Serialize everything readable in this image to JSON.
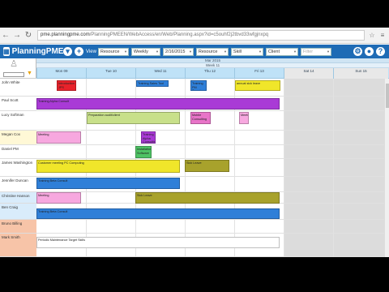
{
  "browser": {
    "url_domain": "pme.planningpme.com",
    "url_path": "/PlanningPMEEN/WebAccess/en/Web/Planning.aspx?id=c5ouhf2j2tbvd33wfgjnxpq"
  },
  "app": {
    "name": "PlanningPME"
  },
  "toolbar": {
    "view_label": "View",
    "view_value": "Resource",
    "period_value": "Weekly",
    "date_value": "2/16/2015",
    "resource_filter": "Resource",
    "skill_filter": "Skill",
    "client_filter": "Client",
    "search_placeholder": "Filter"
  },
  "timeline": {
    "month": "Mar 2015",
    "week": "Week 11",
    "days": [
      "Mon 09",
      "Tue 10",
      "Wed 11",
      "Thu 12",
      "Fri 13",
      "Sat 14",
      "Sun 15"
    ]
  },
  "resources": [
    {
      "name": "John White",
      "color": "#ffffff"
    },
    {
      "name": "Paul Scott",
      "color": "#ffffff"
    },
    {
      "name": "Lucy Softman",
      "color": "#ffffff"
    },
    {
      "name": "Megan Cox",
      "color": "#fff8d6"
    },
    {
      "name": "Daniel PM",
      "color": "#ffffff"
    },
    {
      "name": "James Washington",
      "color": "#ffffff"
    },
    {
      "name": "Jennifer Duncan",
      "color": "#ffffff"
    },
    {
      "name": "Christine Hanson",
      "color": "#d9ecfb"
    },
    {
      "name": "Ben Craig",
      "color": "#d9ecfb"
    },
    {
      "name": "Bruno Billing",
      "color": "#f7c4a8"
    },
    {
      "name": "Mark Smith",
      "color": "#f7c4a8"
    }
  ],
  "tasks": [
    {
      "label": "Introduction JPS",
      "color": "#e8222b"
    },
    {
      "label": "Training Sales Tool Client",
      "color": "#2f7fd8"
    },
    {
      "label": "Training PM Target Inc",
      "color": "#2f7fd8"
    },
    {
      "label": "annual sick leave",
      "color": "#f0e62a"
    },
    {
      "label": "Training Alpha Consult",
      "color": "#a93ad6"
    },
    {
      "label": "Preparation audit/client",
      "color": "#c8e08a"
    },
    {
      "label": "Mobile Consulting",
      "color": "#e874c8"
    },
    {
      "label": "Meeting",
      "color": "#f7a8df"
    },
    {
      "label": "Meeting",
      "color": "#f7a8df"
    },
    {
      "label": "Training Alpha Consulting",
      "color": "#a93ad6"
    },
    {
      "label": "Installation Software",
      "color": "#4ec264"
    },
    {
      "label": "Customer meeting PC Computing",
      "color": "#f0e62a"
    },
    {
      "label": "Sick Leave",
      "color": "#a8a22c"
    },
    {
      "label": "Training Beta Consult",
      "color": "#2f7fd8"
    },
    {
      "label": "Meeting",
      "color": "#f7a8df"
    },
    {
      "label": "Sick Leave",
      "color": "#a8a22c"
    },
    {
      "label": "Training Beta Consult",
      "color": "#2f7fd8"
    },
    {
      "label": "Periodic Maintenance Target Skills",
      "color": "#ffffff"
    }
  ]
}
